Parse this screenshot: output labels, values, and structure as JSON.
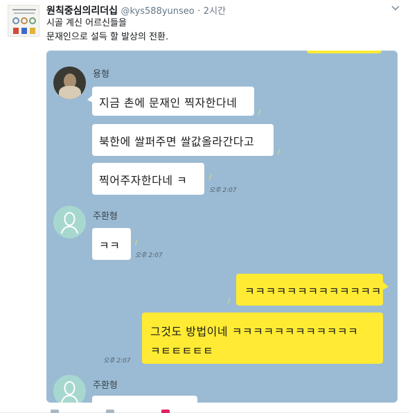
{
  "tweet": {
    "display_name": "원칙중심의리더십",
    "handle": "@kys588yunseo",
    "separator": "·",
    "time": "2시간",
    "text_lines": [
      "시골 계신 어르신들을",
      "문재인으로 설득 할 발상의 전환."
    ],
    "avatar_icon": "book-cover-icon",
    "caret_icon": "chevron-down-icon"
  },
  "chat": {
    "background_color": "#9bbbd4",
    "my_bubble_color": "#ffeb33",
    "their_bubble_color": "#ffffff",
    "senders": {
      "first": "용형",
      "second": "주환형",
      "third": "주환형"
    },
    "messages": {
      "m1": "지금 촌에 문재인 찍자한다네",
      "m2": "북한에 쌀퍼주면 쌀값올라간다고",
      "m3": "찍어주자한다네 ㅋ",
      "m4": "ㅋㅋ",
      "m5": "ㅋㅋㅋㅋㅋㅋㅋㅋㅋㅋㅋㅋㅋ",
      "m6_line1": "그것도 방법이네 ㅋㅋㅋㅋㅋㅋㅋㅋㅋㅋㅋㅋ",
      "m6_line2": "ㅋㅌㅌㅌㅌㅌ"
    },
    "read_mark": "/",
    "timestamps": {
      "t1": "오후 2:07",
      "t2": "오후 2:07",
      "t3": "오후 2:07"
    }
  }
}
